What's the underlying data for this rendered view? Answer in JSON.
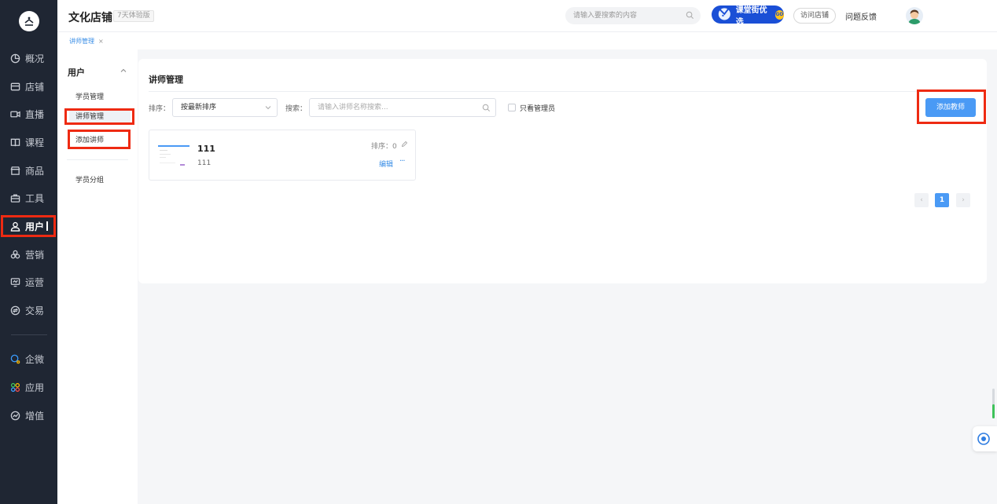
{
  "sidebar": {
    "items": [
      {
        "label": "概况",
        "icon": "pie-chart-icon"
      },
      {
        "label": "店铺",
        "icon": "store-icon"
      },
      {
        "label": "直播",
        "icon": "camera-icon"
      },
      {
        "label": "课程",
        "icon": "book-icon"
      },
      {
        "label": "商品",
        "icon": "shop-icon"
      },
      {
        "label": "工具",
        "icon": "toolbox-icon"
      },
      {
        "label": "用户",
        "icon": "user-icon"
      },
      {
        "label": "营销",
        "icon": "marketing-icon"
      },
      {
        "label": "运营",
        "icon": "monitor-icon"
      },
      {
        "label": "交易",
        "icon": "exchange-icon"
      },
      {
        "label": "企微",
        "icon": "wecom-icon"
      },
      {
        "label": "应用",
        "icon": "apps-icon"
      },
      {
        "label": "增值",
        "icon": "growth-icon"
      }
    ]
  },
  "header": {
    "shop_name": "文化店铺",
    "trial_badge": "7天体验版",
    "search_placeholder": "请输入要搜索的内容",
    "promo_label": "课堂街优选",
    "promo_go": "GO",
    "visit_label": "访问店铺",
    "feedback_label": "问题反馈"
  },
  "tabs": {
    "current": "讲师管理",
    "close": "×"
  },
  "submenu": {
    "title": "用户",
    "items": [
      "学员管理",
      "讲师管理",
      "添加讲师",
      "学员分组"
    ]
  },
  "main": {
    "heading": "讲师管理",
    "sort_label": "排序：",
    "sort_value": "按最新排序",
    "search_label": "搜索：",
    "search_placeholder": "请输入讲师名称搜索...",
    "admin_only_label": "只看管理员",
    "add_button": "添加教师",
    "teachers": [
      {
        "name": "111",
        "desc": "111",
        "sort_text": "排序：0",
        "edit_label": "编辑",
        "more": "···"
      }
    ],
    "pagination": {
      "prev": "‹",
      "current": "1",
      "next": "›"
    }
  },
  "colors": {
    "sidebar_bg": "#1f2633",
    "accent": "#4a9af5",
    "highlight": "#ee2a12"
  }
}
